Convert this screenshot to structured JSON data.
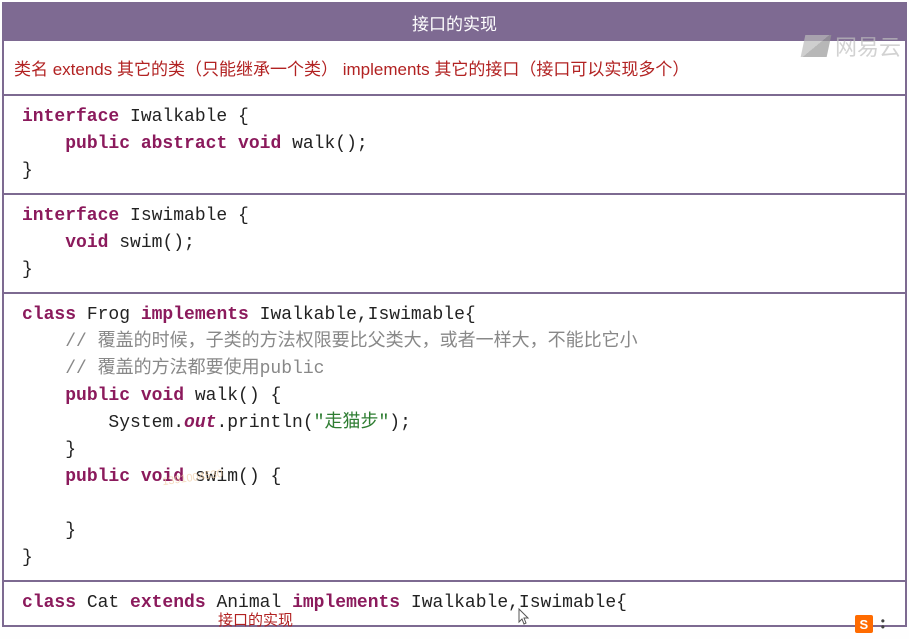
{
  "title": "接口的实现",
  "syntax_line": "类名 extends 其它的类（只能继承一个类）   implements  其它的接口（接口可以实现多个）",
  "code1": {
    "l1a": "interface",
    "l1b": " Iwalkable {",
    "l2a": "public abstract void",
    "l2b": " walk();",
    "l3": "}"
  },
  "code2": {
    "l1a": "interface",
    "l1b": " Iswimable {",
    "l2a": "void",
    "l2b": " swim();",
    "l3": "}"
  },
  "code3": {
    "l1a": "class",
    "l1b": " Frog ",
    "l1c": "implements",
    "l1d": " Iwalkable,Iswimable{",
    "c1": "// 覆盖的时候，子类的方法权限要比父类大，或者一样大，不能比它小",
    "c2": "// 覆盖的方法都要使用public",
    "l4a": "public void",
    "l4b": " walk() {",
    "l5a": "        System.",
    "l5b": "out",
    "l5c": ".println(",
    "l5d": "\"走猫步\"",
    "l5e": ");",
    "l6": "    }",
    "l7a": "public void",
    "l7b": " swim() {",
    "l8": "",
    "l9": "    }",
    "l10": "}"
  },
  "code4": {
    "l1a": "class",
    "l1b": " Cat ",
    "l1c": "extends",
    "l1d": " Animal ",
    "l1e": "implements",
    "l1f": " Iwalkable,Iswimable{"
  },
  "watermark_text": "网易云",
  "watermark_num": "1391004530",
  "footer_label": "接口的实现",
  "sogou_letter": "S"
}
